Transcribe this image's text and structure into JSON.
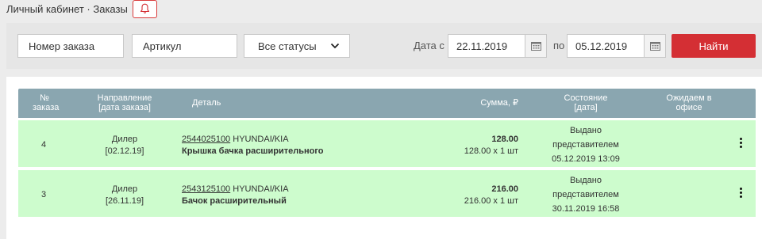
{
  "breadcrumb": "Личный кабинет · Заказы",
  "filters": {
    "order_placeholder": "Номер заказа",
    "article_placeholder": "Артикул",
    "status_value": "Все статусы",
    "date_from_label": "Дата с",
    "date_from": "22.11.2019",
    "date_to_label": "по",
    "date_to": "05.12.2019",
    "find_label": "Найти"
  },
  "table": {
    "headers": {
      "num": "№\nзаказа",
      "direction": "Направление\n[дата заказа]",
      "detail": "Деталь",
      "sum": "Сумма, ₽",
      "state": "Состояние\n[дата]",
      "office": "Ожидаем в\nофисе"
    },
    "rows": [
      {
        "num": "4",
        "direction": "Дилер",
        "order_date": "[02.12.19]",
        "article": "2544025100",
        "brand": "HYUNDAI/KIA",
        "name": "Крышка бачка расширительного",
        "total": "128.00",
        "calc": "128.00 x 1 шт",
        "state1": "Выдано",
        "state2": "представителем",
        "state_date": "05.12.2019 13:09"
      },
      {
        "num": "3",
        "direction": "Дилер",
        "order_date": "[26.11.19]",
        "article": "2543125100",
        "brand": "HYUNDAI/KIA",
        "name": "Бачок расширительный",
        "total": "216.00",
        "calc": "216.00 x 1 шт",
        "state1": "Выдано",
        "state2": "представителем",
        "state_date": "30.11.2019 16:58"
      }
    ]
  },
  "colors": {
    "accent": "#d42f34",
    "header_bg": "#8aa6b0",
    "row_bg": "#cdfccd"
  }
}
